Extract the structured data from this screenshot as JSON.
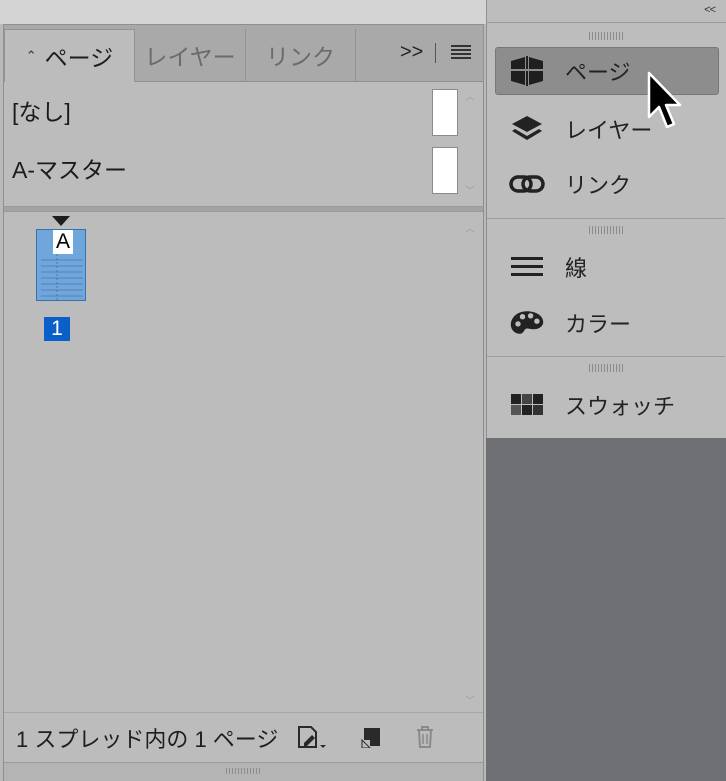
{
  "pages_panel": {
    "tabs": [
      {
        "label": "ページ",
        "active": true
      },
      {
        "label": "レイヤー",
        "active": false
      },
      {
        "label": "リンク",
        "active": false
      }
    ],
    "overflow_label": ">>",
    "masters": [
      {
        "label": "[なし]"
      },
      {
        "label": "A-マスター"
      }
    ],
    "page": {
      "master_prefix": "A",
      "number": "1"
    },
    "status_text": "1 スプレッド内の 1 ページ"
  },
  "dock": {
    "collapse_label": "<<",
    "items": [
      {
        "label": "ページ",
        "icon": "pages-icon",
        "active": true
      },
      {
        "label": "レイヤー",
        "icon": "layers-icon",
        "active": false
      },
      {
        "label": "リンク",
        "icon": "links-icon",
        "active": false
      },
      {
        "label": "線",
        "icon": "stroke-icon",
        "active": false
      },
      {
        "label": "カラー",
        "icon": "color-palette-icon",
        "active": false
      },
      {
        "label": "スウォッチ",
        "icon": "swatches-icon",
        "active": false
      }
    ]
  },
  "colors": {
    "panel_bg": "#bcbcbc",
    "dock_bg": "#bdbdbd",
    "workspace_bg": "#6f7074",
    "selection_blue": "#0a60c8",
    "page_thumb_blue": "#6fa6dc"
  }
}
